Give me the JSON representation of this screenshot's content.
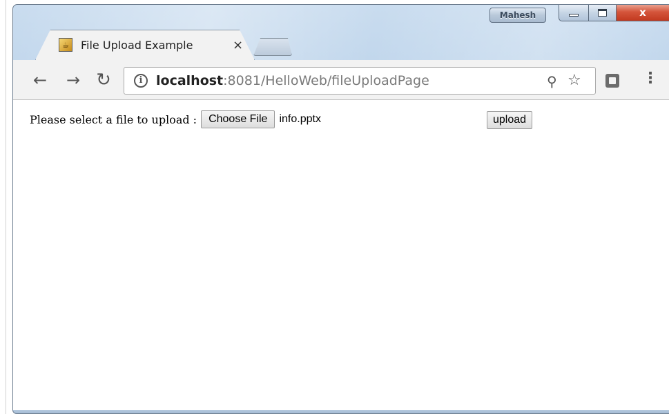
{
  "window": {
    "profile_name": "Mahesh",
    "close_glyph": "x"
  },
  "tabs": [
    {
      "title": "File Upload Example",
      "close_glyph": "×",
      "icon": "java-favicon-icon"
    }
  ],
  "toolbar": {
    "url_host": "localhost",
    "url_rest": ":8081/HelloWeb/fileUploadPage",
    "icons": [
      "back-arrow-icon",
      "forward-arrow-icon",
      "reload-icon",
      "info-icon",
      "zoom-icon",
      "star-icon",
      "extension-icon",
      "menu-icon"
    ]
  },
  "form": {
    "label": "Please select a file to upload :",
    "choose_label": "Choose File",
    "file_name": "info.pptx",
    "upload_label": "upload"
  },
  "colors": {
    "frame": "#b6cfe8",
    "close_button": "#d4543a",
    "toolbar": "#f2f2f2"
  }
}
